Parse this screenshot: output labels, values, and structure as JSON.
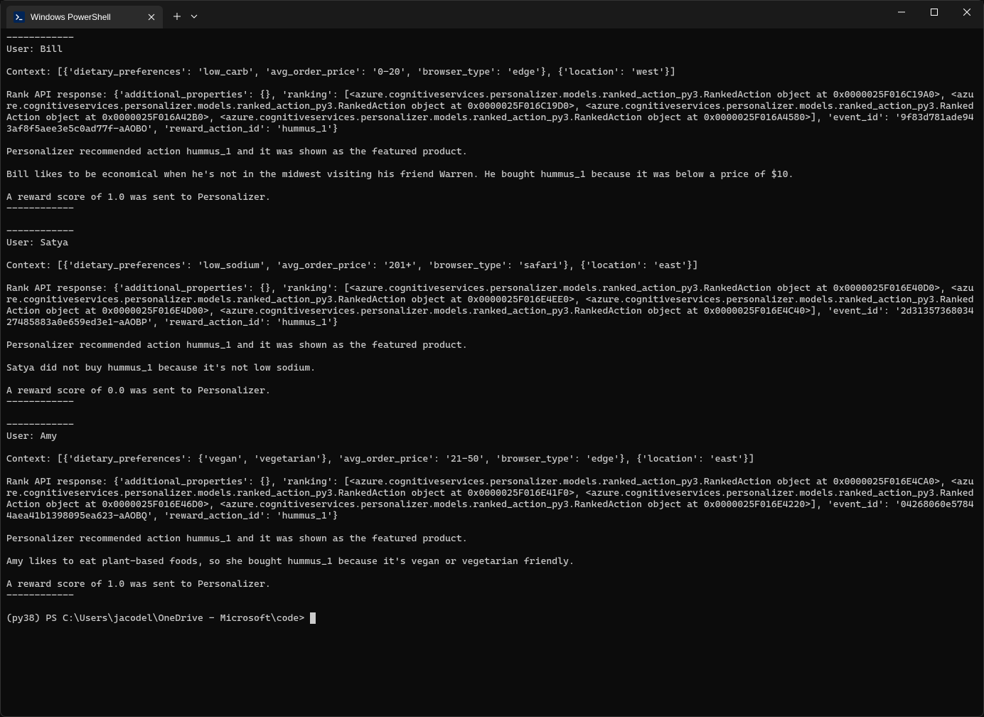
{
  "tab": {
    "title": "Windows PowerShell"
  },
  "terminal": {
    "lines": [
      "------------",
      "User: Bill",
      "",
      "Context: [{'dietary_preferences': 'low_carb', 'avg_order_price': '0-20', 'browser_type': 'edge'}, {'location': 'west'}]",
      "",
      "Rank API response: {'additional_properties': {}, 'ranking': [<azure.cognitiveservices.personalizer.models.ranked_action_py3.RankedAction object at 0x0000025F016C19A0>, <azure.cognitiveservices.personalizer.models.ranked_action_py3.RankedAction object at 0x0000025F016C19D0>, <azure.cognitiveservices.personalizer.models.ranked_action_py3.RankedAction object at 0x0000025F016A42B0>, <azure.cognitiveservices.personalizer.models.ranked_action_py3.RankedAction object at 0x0000025F016A4580>], 'event_id': '9f83d781ade943af8f5aee3e5c0ad77f-aAOBO', 'reward_action_id': 'hummus_1'}",
      "",
      "Personalizer recommended action hummus_1 and it was shown as the featured product.",
      "",
      "Bill likes to be economical when he's not in the midwest visiting his friend Warren. He bought hummus_1 because it was below a price of $10.",
      "",
      "A reward score of 1.0 was sent to Personalizer.",
      "------------",
      "",
      "------------",
      "User: Satya",
      "",
      "Context: [{'dietary_preferences': 'low_sodium', 'avg_order_price': '201+', 'browser_type': 'safari'}, {'location': 'east'}]",
      "",
      "Rank API response: {'additional_properties': {}, 'ranking': [<azure.cognitiveservices.personalizer.models.ranked_action_py3.RankedAction object at 0x0000025F016E40D0>, <azure.cognitiveservices.personalizer.models.ranked_action_py3.RankedAction object at 0x0000025F016E4EE0>, <azure.cognitiveservices.personalizer.models.ranked_action_py3.RankedAction object at 0x0000025F016E4D00>, <azure.cognitiveservices.personalizer.models.ranked_action_py3.RankedAction object at 0x0000025F016E4C40>], 'event_id': '2d3135736803427485883a0e659ed3e1-aAOBP', 'reward_action_id': 'hummus_1'}",
      "",
      "Personalizer recommended action hummus_1 and it was shown as the featured product.",
      "",
      "Satya did not buy hummus_1 because it's not low sodium.",
      "",
      "A reward score of 0.0 was sent to Personalizer.",
      "------------",
      "",
      "------------",
      "User: Amy",
      "",
      "Context: [{'dietary_preferences': {'vegan', 'vegetarian'}, 'avg_order_price': '21-50', 'browser_type': 'edge'}, {'location': 'east'}]",
      "",
      "Rank API response: {'additional_properties': {}, 'ranking': [<azure.cognitiveservices.personalizer.models.ranked_action_py3.RankedAction object at 0x0000025F016E4CA0>, <azure.cognitiveservices.personalizer.models.ranked_action_py3.RankedAction object at 0x0000025F016E41F0>, <azure.cognitiveservices.personalizer.models.ranked_action_py3.RankedAction object at 0x0000025F016E46D0>, <azure.cognitiveservices.personalizer.models.ranked_action_py3.RankedAction object at 0x0000025F016E4220>], 'event_id': '04268060e57844aea41b1398095ea623-aAOBQ', 'reward_action_id': 'hummus_1'}",
      "",
      "Personalizer recommended action hummus_1 and it was shown as the featured product.",
      "",
      "Amy likes to eat plant-based foods, so she bought hummus_1 because it's vegan or vegetarian friendly.",
      "",
      "A reward score of 1.0 was sent to Personalizer.",
      "------------",
      ""
    ],
    "prompt": "(py38) PS C:\\Users\\jacodel\\OneDrive - Microsoft\\code> "
  }
}
